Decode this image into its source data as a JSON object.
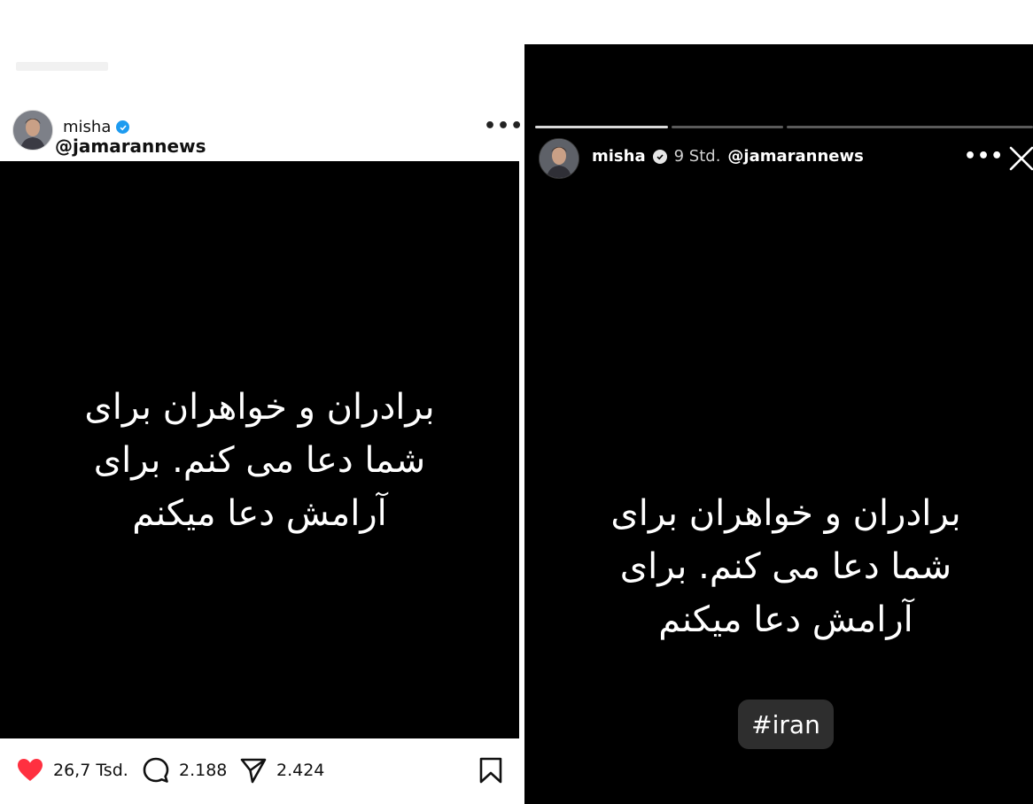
{
  "post": {
    "username": "misha",
    "handle": "@jamarannews",
    "more_label": "•••",
    "caption_image_text": "برادران و خواهران برای\nشما دعا می کنم. برای\nآرامش دعا میکنم",
    "likes": "26,7 Tsd.",
    "comments": "2.188",
    "shares": "2.424"
  },
  "story": {
    "username": "misha",
    "time": "9 Std.",
    "handle": "@jamarannews",
    "more_label": "•••",
    "text": "برادران و خواهران برای\nشما دعا می کنم. برای\nآرامش دعا میکنم",
    "hashtag": "#iran",
    "progress_segments": 3,
    "current_segment": 1
  },
  "colors": {
    "like_red": "#ff3040",
    "verified_blue": "#1d9bf0",
    "story_bg": "#000000"
  },
  "icons": [
    "heart-icon",
    "comment-icon",
    "share-icon",
    "bookmark-icon",
    "verified-icon",
    "close-icon",
    "more-icon"
  ]
}
